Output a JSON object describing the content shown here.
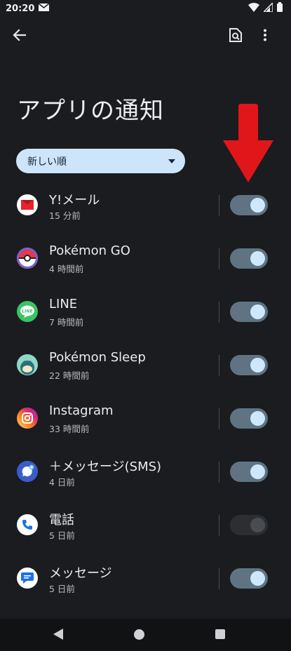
{
  "status_bar": {
    "time": "20:20",
    "icons": [
      "mail-icon",
      "wifi-icon",
      "signal-icon",
      "battery-icon"
    ]
  },
  "top_bar": {
    "back_icon": "arrow-left-icon",
    "search_icon": "search-in-page-icon",
    "more_icon": "more-vertical-icon"
  },
  "page": {
    "title": "アプリの通知"
  },
  "sort": {
    "selected": "新しい順"
  },
  "apps": [
    {
      "name": "Y!メール",
      "time": "15 分前",
      "enabled": true,
      "icon": "ymail-icon"
    },
    {
      "name": "Pokémon GO",
      "time": "4 時間前",
      "enabled": true,
      "icon": "pokemon-go-icon"
    },
    {
      "name": "LINE",
      "time": "7 時間前",
      "enabled": true,
      "icon": "line-icon"
    },
    {
      "name": "Pokémon Sleep",
      "time": "22 時間前",
      "enabled": true,
      "icon": "pokemon-sleep-icon"
    },
    {
      "name": "Instagram",
      "time": "33 時間前",
      "enabled": true,
      "icon": "instagram-icon"
    },
    {
      "name": "＋メッセージ(SMS)",
      "time": "4 日前",
      "enabled": true,
      "icon": "plus-message-icon"
    },
    {
      "name": "電話",
      "time": "5 日前",
      "enabled": false,
      "icon": "phone-icon"
    },
    {
      "name": "メッセージ",
      "time": "5 日前",
      "enabled": true,
      "icon": "messages-icon"
    }
  ],
  "colors": {
    "background": "#1b1c1f",
    "accent": "#cde5fb",
    "toggle_on_track": "#5f7382",
    "annotation_arrow": "#e0161b"
  }
}
